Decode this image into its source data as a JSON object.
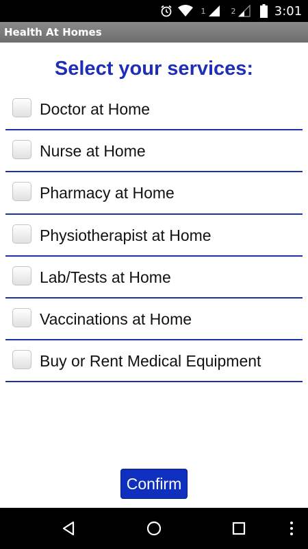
{
  "status_bar": {
    "icons": [
      "alarm-icon",
      "wifi-icon",
      "signal-sim1-icon",
      "signal-sim2-icon",
      "battery-icon"
    ],
    "sim1_label": "1",
    "sim2_label": "2",
    "time": "3:01"
  },
  "app": {
    "title": "Health At Homes"
  },
  "main": {
    "heading": "Select your services:",
    "services": [
      {
        "label": "Doctor at Home",
        "checked": false
      },
      {
        "label": "Nurse at Home",
        "checked": false
      },
      {
        "label": "Pharmacy at Home",
        "checked": false
      },
      {
        "label": "Physiotherapist at Home",
        "checked": false
      },
      {
        "label": "Lab/Tests at Home",
        "checked": false
      },
      {
        "label": "Vaccinations at Home",
        "checked": false
      },
      {
        "label": "Buy or Rent Medical Equipment",
        "checked": false
      }
    ],
    "confirm_label": "Confirm"
  },
  "nav_bar": {
    "icons": [
      "back-icon",
      "home-icon",
      "recents-icon",
      "more-icon"
    ]
  },
  "colors": {
    "heading": "#1f2fb5",
    "divider": "#1f2fa8",
    "button": "#0f2fbf",
    "title_bar": "#7a7a7a"
  }
}
